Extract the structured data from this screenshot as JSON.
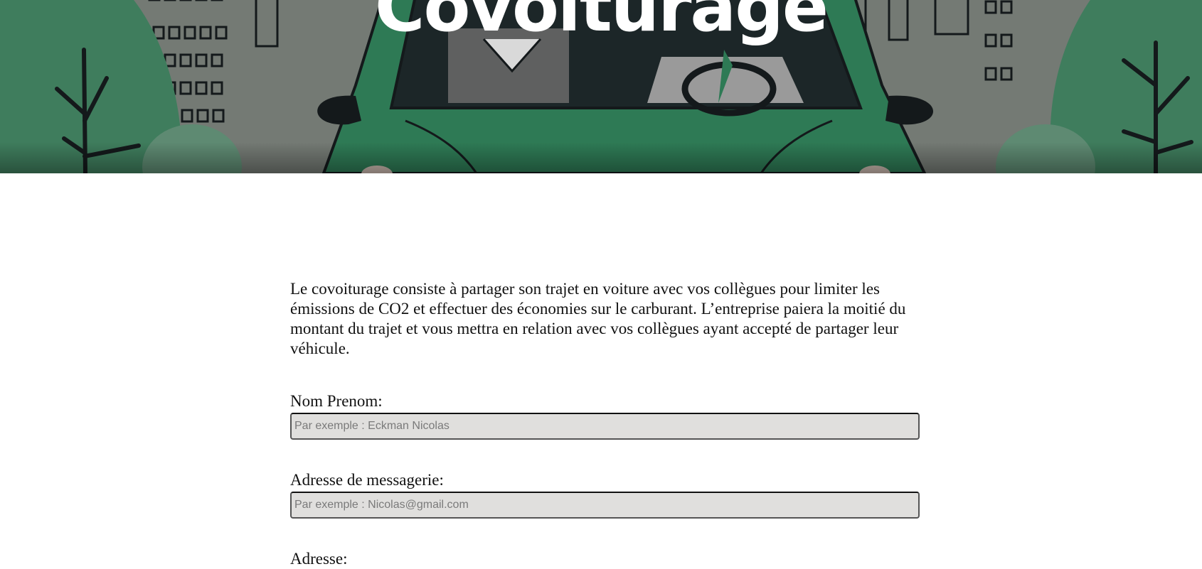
{
  "hero": {
    "title": "Covoiturage"
  },
  "intro": {
    "text": "Le covoiturage consiste à partager son trajet en voiture avec vos collègues pour limiter les émissions de CO2 et effectuer des économies sur le carburant. L’entreprise paiera la moitié du montant du trajet et vous mettra en relation avec vos collègues ayant accepté de partager leur véhicule."
  },
  "form": {
    "name": {
      "label": "Nom Prenom:",
      "value": "",
      "placeholder": "Par exemple : Eckman Nicolas"
    },
    "email": {
      "label": "Adresse de messagerie:",
      "value": "",
      "placeholder": "Par exemple : Nicolas@gmail.com"
    },
    "address": {
      "label": "Adresse:"
    }
  },
  "colors": {
    "hero_background": "#747a74",
    "car_green": "#2e7a55",
    "tree_green": "#3f7d5d",
    "outline": "#14191b",
    "input_background": "#e0dfdd"
  },
  "icons": {
    "hero_illustration": "carpool-illustration"
  }
}
